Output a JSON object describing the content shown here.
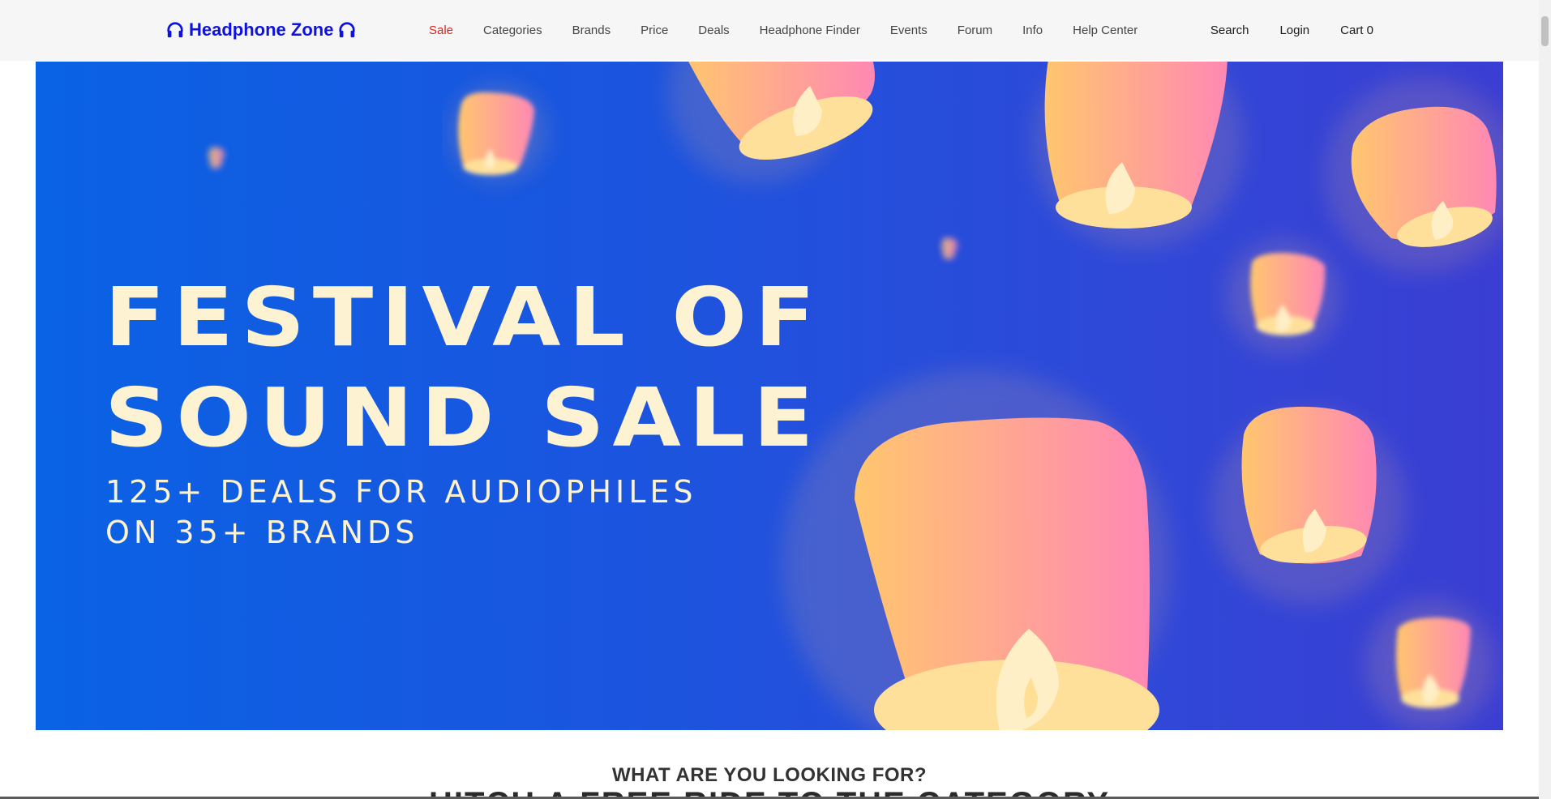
{
  "logo": {
    "text": "Headphone Zone",
    "left_icon": "headphones-icon",
    "right_icon": "headphones-icon",
    "color": "#0d12e0"
  },
  "nav": {
    "items": [
      {
        "label": "Sale",
        "color": "#e0241b"
      },
      {
        "label": "Categories"
      },
      {
        "label": "Brands"
      },
      {
        "label": "Price"
      },
      {
        "label": "Deals"
      },
      {
        "label": "Headphone Finder"
      },
      {
        "label": "Events"
      },
      {
        "label": "Forum"
      },
      {
        "label": "Info"
      },
      {
        "label": "Help Center"
      }
    ],
    "search_label": "Search",
    "login_label": "Login",
    "cart_label": "Cart 0"
  },
  "hero": {
    "title_line1": "FESTIVAL OF",
    "title_line2": "SOUND SALE",
    "subtitle_line1": "125+ DEALS FOR AUDIOPHILES",
    "subtitle_line2": "ON 35+ BRANDS",
    "background_colors": [
      "#0a62e4",
      "#3a3ed2"
    ],
    "text_color": "#fdf3d2"
  },
  "sections": {
    "looking_heading": "WHAT ARE YOU LOOKING FOR?",
    "cut_heading": "HITCH A FREE RIDE TO THE CATEGORY"
  }
}
